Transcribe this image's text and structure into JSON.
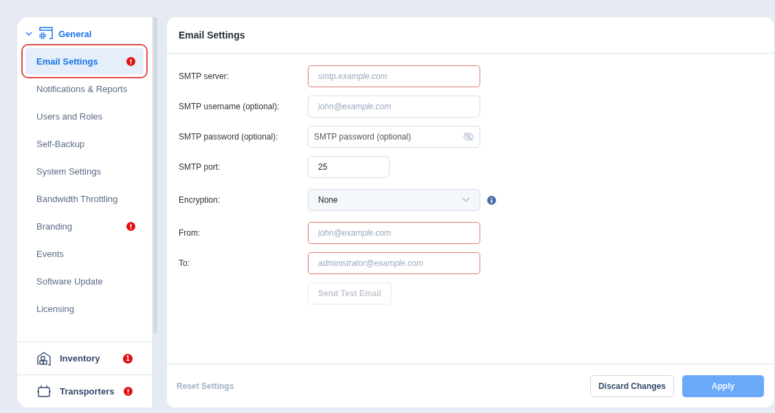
{
  "sidebar": {
    "group": {
      "label": "General",
      "expanded": true
    },
    "items": [
      {
        "label": "Email Settings",
        "selected": true,
        "alert": true
      },
      {
        "label": "Notifications & Reports",
        "selected": false,
        "alert": false
      },
      {
        "label": "Users and Roles",
        "selected": false,
        "alert": false
      },
      {
        "label": "Self-Backup",
        "selected": false,
        "alert": false
      },
      {
        "label": "System Settings",
        "selected": false,
        "alert": false
      },
      {
        "label": "Bandwidth Throttling",
        "selected": false,
        "alert": false
      },
      {
        "label": "Branding",
        "selected": false,
        "alert": true
      },
      {
        "label": "Events",
        "selected": false,
        "alert": false
      },
      {
        "label": "Software Update",
        "selected": false,
        "alert": false
      },
      {
        "label": "Licensing",
        "selected": false,
        "alert": false
      }
    ],
    "sections": [
      {
        "kind": "inventory",
        "label": "Inventory",
        "count": "1"
      },
      {
        "kind": "transporters",
        "label": "Transporters",
        "alert": true
      }
    ]
  },
  "panel": {
    "title": "Email Settings",
    "fields": [
      {
        "kind": "text",
        "label": "SMTP server:",
        "placeholder": "smtp.example.com",
        "invalid": true
      },
      {
        "kind": "text",
        "label": "SMTP username (optional):",
        "placeholder": "john@example.com",
        "invalid": false
      },
      {
        "kind": "password",
        "label": "SMTP password (optional):",
        "placeholder": "SMTP password (optional)",
        "invalid": false
      },
      {
        "kind": "port",
        "label": "SMTP port:",
        "value": "25",
        "invalid": false
      },
      {
        "kind": "select",
        "label": "Encryption:",
        "value": "None",
        "invalid": false
      },
      {
        "kind": "text",
        "label": "From:",
        "placeholder": "john@example.com",
        "invalid": true
      },
      {
        "kind": "text",
        "label": "To:",
        "placeholder": "administrator@example.com",
        "invalid": true
      }
    ],
    "test_button": {
      "label": "Send Test Email",
      "disabled": true
    },
    "footer": {
      "reset": {
        "label": "Reset Settings",
        "disabled": true
      },
      "discard": {
        "label": "Discard Changes",
        "disabled": false
      },
      "apply": {
        "label": "Apply",
        "disabled": true
      }
    }
  }
}
